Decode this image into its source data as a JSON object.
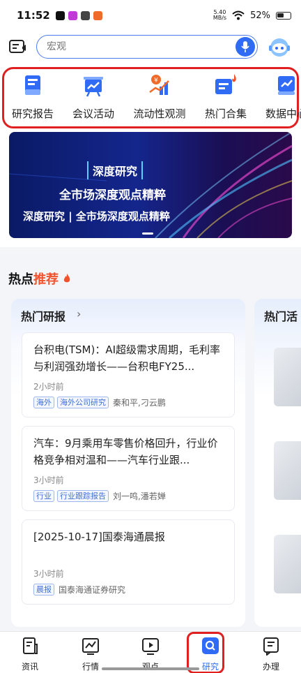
{
  "status_bar": {
    "time": "11:52",
    "net_speed": "5.40",
    "net_unit": "MB/s",
    "battery": "52%"
  },
  "search": {
    "placeholder": "宏观"
  },
  "quick_menu": [
    {
      "label": "研究报告",
      "icon": "report-icon"
    },
    {
      "label": "会议活动",
      "icon": "presentation-icon"
    },
    {
      "label": "流动性观测",
      "icon": "liquidity-chart-icon"
    },
    {
      "label": "热门合集",
      "icon": "hot-collection-icon"
    },
    {
      "label": "数据中心",
      "icon": "data-center-icon"
    }
  ],
  "banner": {
    "tag": "深度研究",
    "title": "全市场深度观点精粹",
    "subtitle": "深度研究 | 全市场深度观点精粹"
  },
  "hot": {
    "title_prefix": "热点",
    "title_accent": "推荐",
    "card_title": "热门研报",
    "side_card_title": "热门活",
    "reports": [
      {
        "title": "台积电(TSM)：AI超级需求周期，毛利率与利润强劲增长——台积电FY25...",
        "time": "2小时前",
        "tags": [
          "海外",
          "海外公司研究"
        ],
        "author": "秦和平,刁云鹏"
      },
      {
        "title": "汽车：9月乘用车零售价格回升，行业价格竞争相对温和——汽车行业跟...",
        "time": "3小时前",
        "tags": [
          "行业",
          "行业跟踪报告"
        ],
        "author": "刘一鸣,潘若婵"
      },
      {
        "title": "[2025-10-17]国泰海通晨报",
        "time": "3小时前",
        "tags": [
          "晨报"
        ],
        "author": "国泰海通证券研究"
      }
    ]
  },
  "nav": [
    {
      "label": "资讯",
      "icon": "news-icon"
    },
    {
      "label": "行情",
      "icon": "market-icon"
    },
    {
      "label": "观点",
      "icon": "video-icon"
    },
    {
      "label": "研究",
      "icon": "research-search-icon"
    },
    {
      "label": "办理",
      "icon": "handle-icon"
    }
  ],
  "colors": {
    "accent": "#2f6bf5",
    "highlight_outline": "#e02020",
    "hot_accent": "#f0522e"
  }
}
